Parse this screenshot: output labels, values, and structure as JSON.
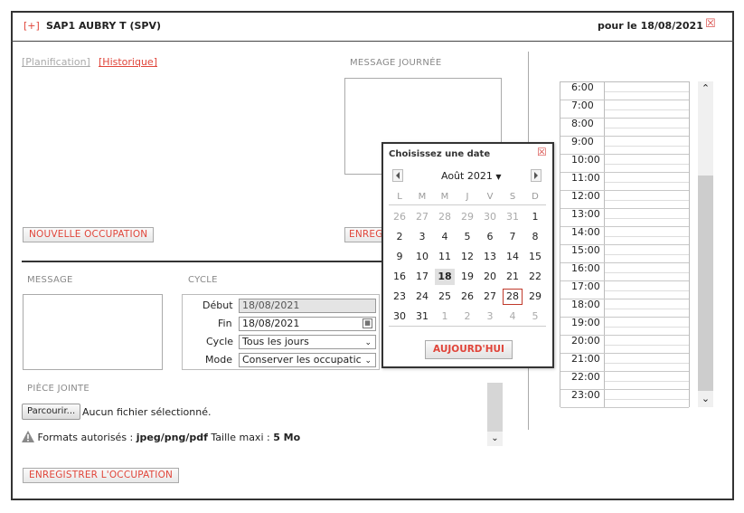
{
  "header": {
    "expand_label": "[+]",
    "title": "SAP1 AUBRY T (SPV)",
    "date_label": "pour le 18/08/2021",
    "close_glyph": "☒"
  },
  "links": {
    "planification": "[Planification]",
    "historique": "[Historique]"
  },
  "message_journee": {
    "label": "MESSAGE JOURNÉE"
  },
  "buttons": {
    "nouvelle_occupation": "NOUVELLE OCCUPATION",
    "enregistrer_partial": "ENREG",
    "enregistrer_occupation": "ENREGISTRER L'OCCUPATION",
    "parcourir": "Parcourir..."
  },
  "form": {
    "message_label": "MESSAGE",
    "cycle_section_label": "CYCLE",
    "debut_label": "Début",
    "debut_value": "18/08/2021",
    "fin_label": "Fin",
    "fin_value": "18/08/2021",
    "cycle_label": "Cycle",
    "cycle_value": "Tous les jours",
    "mode_label": "Mode",
    "mode_value": "Conserver les occupatic",
    "piece_jointe_label": "PIÈCE JOINTE",
    "file_status": "Aucun fichier sélectionné.",
    "formats_prefix": "Formats autorisés : ",
    "formats_value": "jpeg/png/pdf",
    "size_prefix": " Taille maxi : ",
    "size_value": "5 Mo"
  },
  "calendar": {
    "title": "Choisissez une date",
    "month_label": "Août 2021",
    "weekdays": [
      "L",
      "M",
      "M",
      "J",
      "V",
      "S",
      "D"
    ],
    "weeks": [
      [
        "26",
        "27",
        "28",
        "29",
        "30",
        "31",
        "1"
      ],
      [
        "2",
        "3",
        "4",
        "5",
        "6",
        "7",
        "8"
      ],
      [
        "9",
        "10",
        "11",
        "12",
        "13",
        "14",
        "15"
      ],
      [
        "16",
        "17",
        "18",
        "19",
        "20",
        "21",
        "22"
      ],
      [
        "23",
        "24",
        "25",
        "26",
        "27",
        "28",
        "29"
      ],
      [
        "30",
        "31",
        "1",
        "2",
        "3",
        "4",
        "5"
      ]
    ],
    "selected_day": "18",
    "today_day": "28",
    "today_button": "AUJOURD'HUI"
  },
  "schedule": {
    "times": [
      "6:00",
      "7:00",
      "8:00",
      "9:00",
      "10:00",
      "11:00",
      "12:00",
      "13:00",
      "14:00",
      "15:00",
      "16:00",
      "17:00",
      "18:00",
      "19:00",
      "20:00",
      "21:00",
      "22:00",
      "23:00"
    ]
  },
  "colors": {
    "accent": "#e0453a",
    "border": "#333333"
  }
}
